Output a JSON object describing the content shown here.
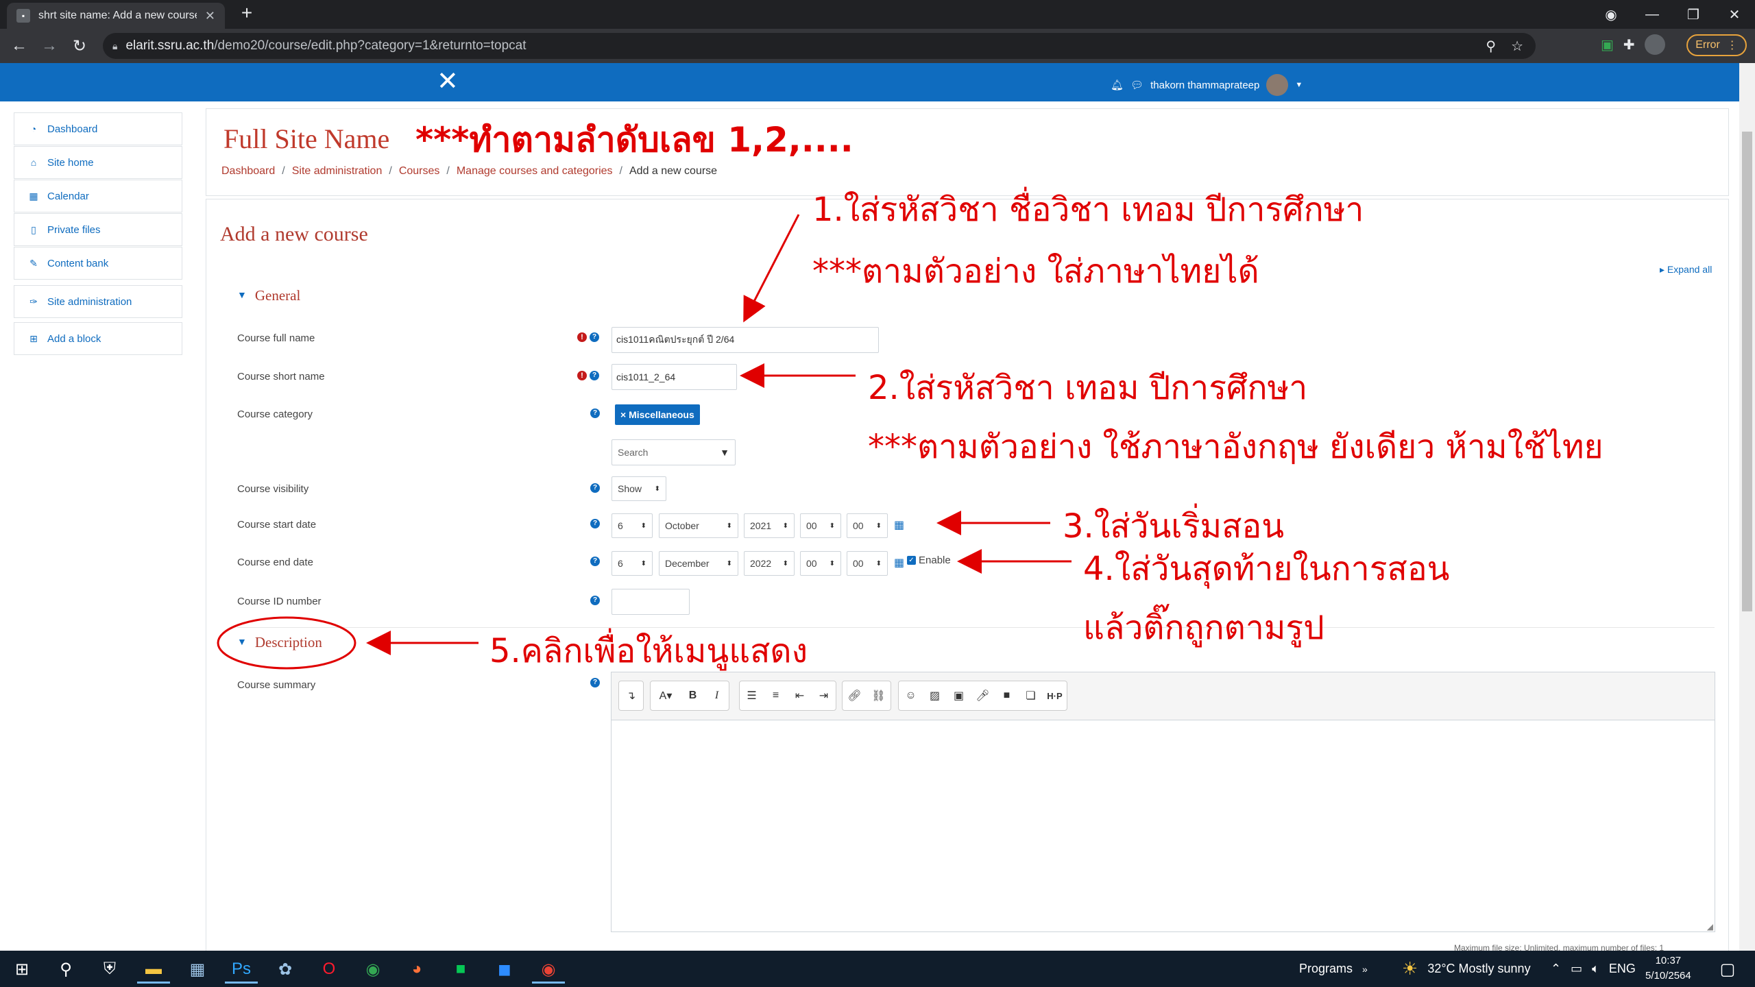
{
  "browser": {
    "tab_title": "shrt site name: Add a new course",
    "url_host": "elarit.ssru.ac.th",
    "url_path": "/demo20/course/edit.php?category=1&returnto=topcat",
    "error_label": "Error"
  },
  "navbar": {
    "user_name": "thakorn thammaprateep"
  },
  "blocks": [
    {
      "label": "Dashboard",
      "icon": "dashboard-icon"
    },
    {
      "label": "Site home",
      "icon": "home-icon"
    },
    {
      "label": "Calendar",
      "icon": "calendar-icon"
    },
    {
      "label": "Private files",
      "icon": "file-icon"
    },
    {
      "label": "Content bank",
      "icon": "paint-brush-icon"
    },
    {
      "label": "Site administration",
      "icon": "wrench-icon"
    },
    {
      "label": "Add a block",
      "icon": "plus-square-icon"
    }
  ],
  "header": {
    "site_name": "Full Site Name",
    "note": "***ทำตามลำดับเลข 1,2,....",
    "breadcrumb": [
      "Dashboard",
      "Site administration",
      "Courses",
      "Manage courses and categories",
      "Add a new course"
    ]
  },
  "page": {
    "heading": "Add a new course",
    "expand_all": "Expand all",
    "general": "General",
    "description": "Description"
  },
  "form": {
    "full_name_label": "Course full name",
    "full_name_value": "cis1011คณิตประยุกต์ ปี 2/64",
    "short_name_label": "Course short name",
    "short_name_value": "cis1011_2_64",
    "category_label": "Course category",
    "category_tag": "× Miscellaneous",
    "category_search": "Search",
    "visibility_label": "Course visibility",
    "visibility_value": "Show",
    "start_label": "Course start date",
    "start_day": "6",
    "start_month": "October",
    "start_year": "2021",
    "start_hour": "00",
    "start_minute": "00",
    "end_label": "Course end date",
    "end_day": "6",
    "end_month": "December",
    "end_year": "2022",
    "end_hour": "00",
    "end_minute": "00",
    "enable_label": "Enable",
    "id_label": "Course ID number",
    "summary_label": "Course summary",
    "max_size": "Maximum file size: Unlimited, maximum number of files: 1"
  },
  "annotations": {
    "a1_line1": "1.ใส่รหัสวิชา ชื่อวิชา เทอม ปีการศึกษา",
    "a1_line2": "***ตามตัวอย่าง ใส่ภาษาไทยได้",
    "a2_line1": "2.ใส่รหัสวิชา เทอม ปีการศึกษา",
    "a2_line2": "***ตามตัวอย่าง ใช้ภาษาอังกฤษ ยังเดียว ห้ามใช้ไทย",
    "a3": "3.ใส่วันเริ่มสอน",
    "a4_line1": "4.ใส่วันสุดท้ายในการสอน",
    "a4_line2": "แล้วติ๊กถูกตามรูป",
    "a5": "5.คลิกเพื่อให้เมนูแสดง"
  },
  "taskbar": {
    "programs": "Programs",
    "weather": "32°C  Mostly sunny",
    "lang": "ENG",
    "time": "10:37",
    "date": "5/10/2564"
  },
  "colors": {
    "moodle_blue": "#0f6cbf",
    "heading_red": "#b03a2e",
    "annotation_red": "#e00000"
  }
}
